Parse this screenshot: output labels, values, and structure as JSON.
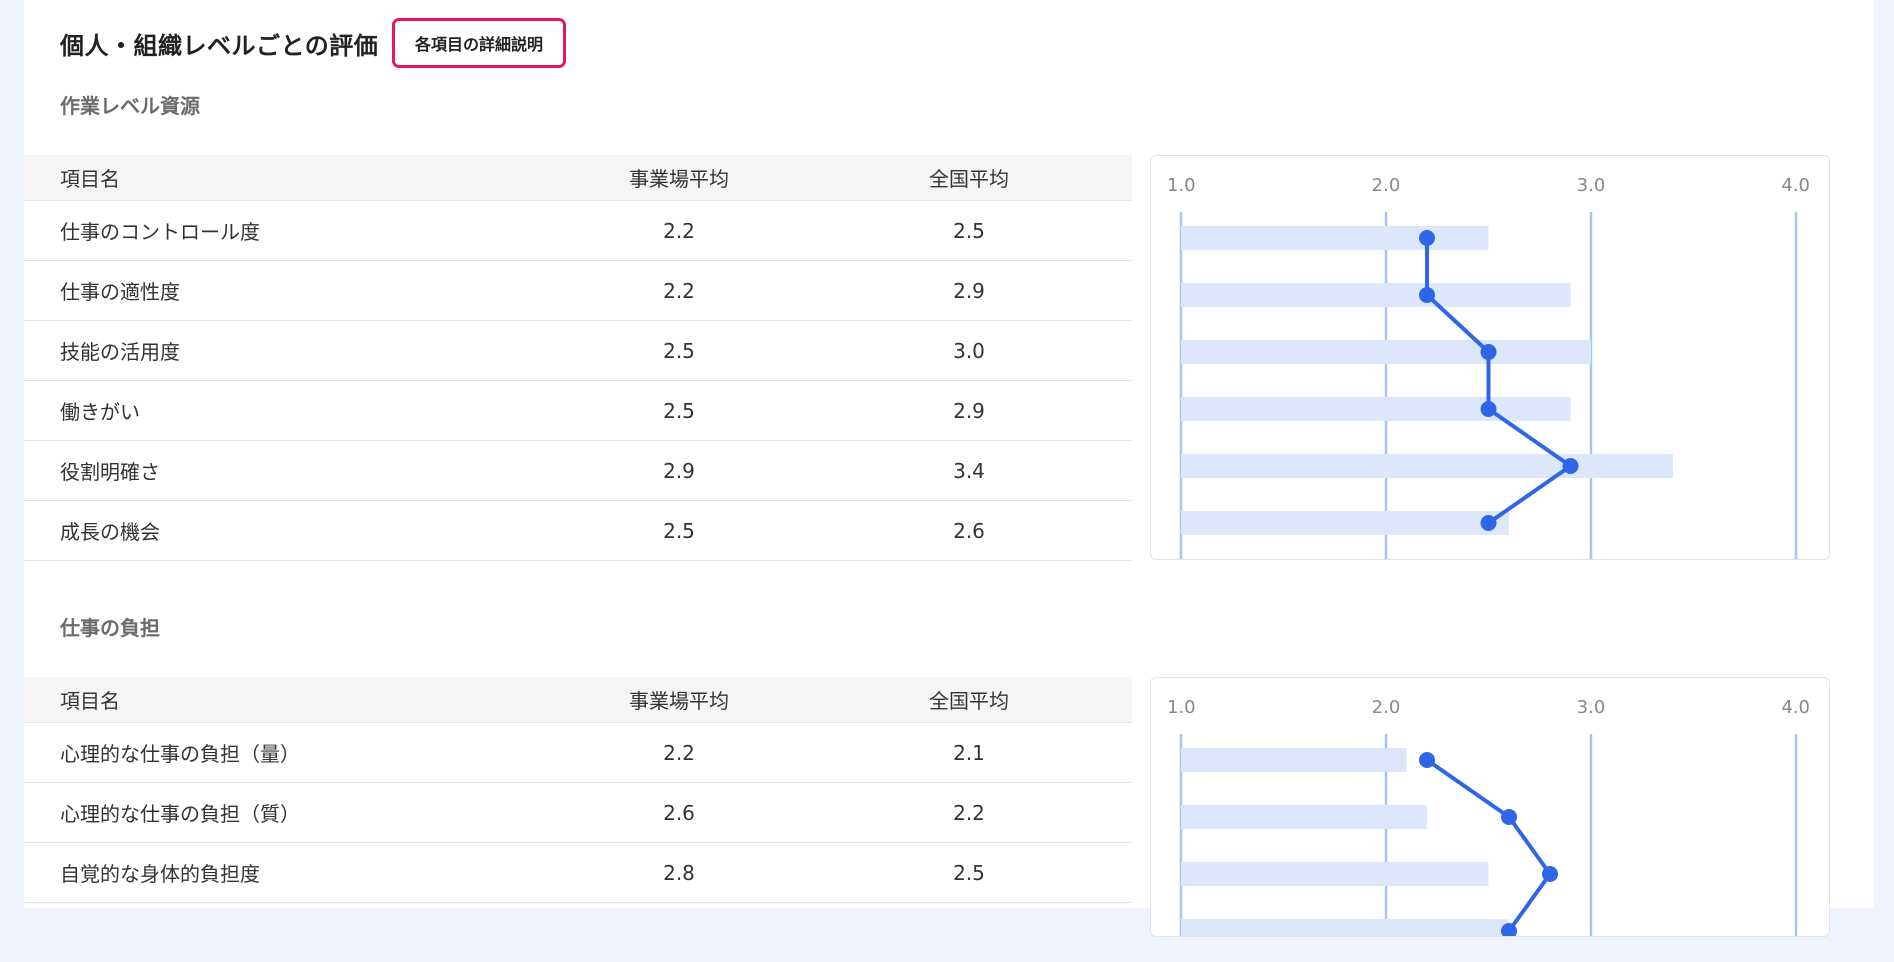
{
  "page": {
    "title": "個人・組織レベルごとの評価",
    "detail_button": "各項目の詳細説明"
  },
  "table_headers": {
    "name": "項目名",
    "site": "事業場平均",
    "national": "全国平均"
  },
  "sections": [
    {
      "title": "作業レベル資源",
      "rows": [
        {
          "name": "仕事のコントロール度",
          "site": "2.2",
          "national": "2.5"
        },
        {
          "name": "仕事の適性度",
          "site": "2.2",
          "national": "2.9"
        },
        {
          "name": "技能の活用度",
          "site": "2.5",
          "national": "3.0"
        },
        {
          "name": "働きがい",
          "site": "2.5",
          "national": "2.9"
        },
        {
          "name": "役割明確さ",
          "site": "2.9",
          "national": "3.4"
        },
        {
          "name": "成長の機会",
          "site": "2.5",
          "national": "2.6"
        }
      ]
    },
    {
      "title": "仕事の負担",
      "rows": [
        {
          "name": "心理的な仕事の負担（量）",
          "site": "2.2",
          "national": "2.1"
        },
        {
          "name": "心理的な仕事の負担（質）",
          "site": "2.6",
          "national": "2.2"
        },
        {
          "name": "自覚的な身体的負担度",
          "site": "2.8",
          "national": "2.5"
        }
      ]
    }
  ],
  "chart_data": [
    {
      "type": "bar",
      "x_ticks": [
        "1.0",
        "2.0",
        "3.0",
        "4.0"
      ],
      "xlim": [
        1.0,
        4.0
      ],
      "categories": [
        "仕事のコントロール度",
        "仕事の適性度",
        "技能の活用度",
        "働きがい",
        "役割明確さ",
        "成長の機会"
      ],
      "series": [
        {
          "values": [
            2.5,
            2.9,
            3.0,
            2.9,
            3.4,
            2.6
          ]
        },
        {
          "values": [
            2.2,
            2.2,
            2.5,
            2.5,
            2.9,
            2.5
          ]
        }
      ],
      "colors": {
        "bar": "#dce7fb",
        "line": "#2f66e8",
        "grid": "#a9c4f2",
        "tick": "#888888"
      }
    },
    {
      "type": "bar",
      "x_ticks": [
        "1.0",
        "2.0",
        "3.0",
        "4.0"
      ],
      "xlim": [
        1.0,
        4.0
      ],
      "categories": [
        "心理的な仕事の負担（量）",
        "心理的な仕事の負担（質）",
        "自覚的な身体的負担度",
        ""
      ],
      "series": [
        {
          "values": [
            2.1,
            2.2,
            2.5,
            2.6
          ]
        },
        {
          "values": [
            2.2,
            2.6,
            2.8,
            2.6
          ]
        }
      ],
      "colors": {
        "bar": "#dce7fb",
        "line": "#2f66e8",
        "grid": "#a9c4f2",
        "tick": "#888888"
      }
    }
  ]
}
